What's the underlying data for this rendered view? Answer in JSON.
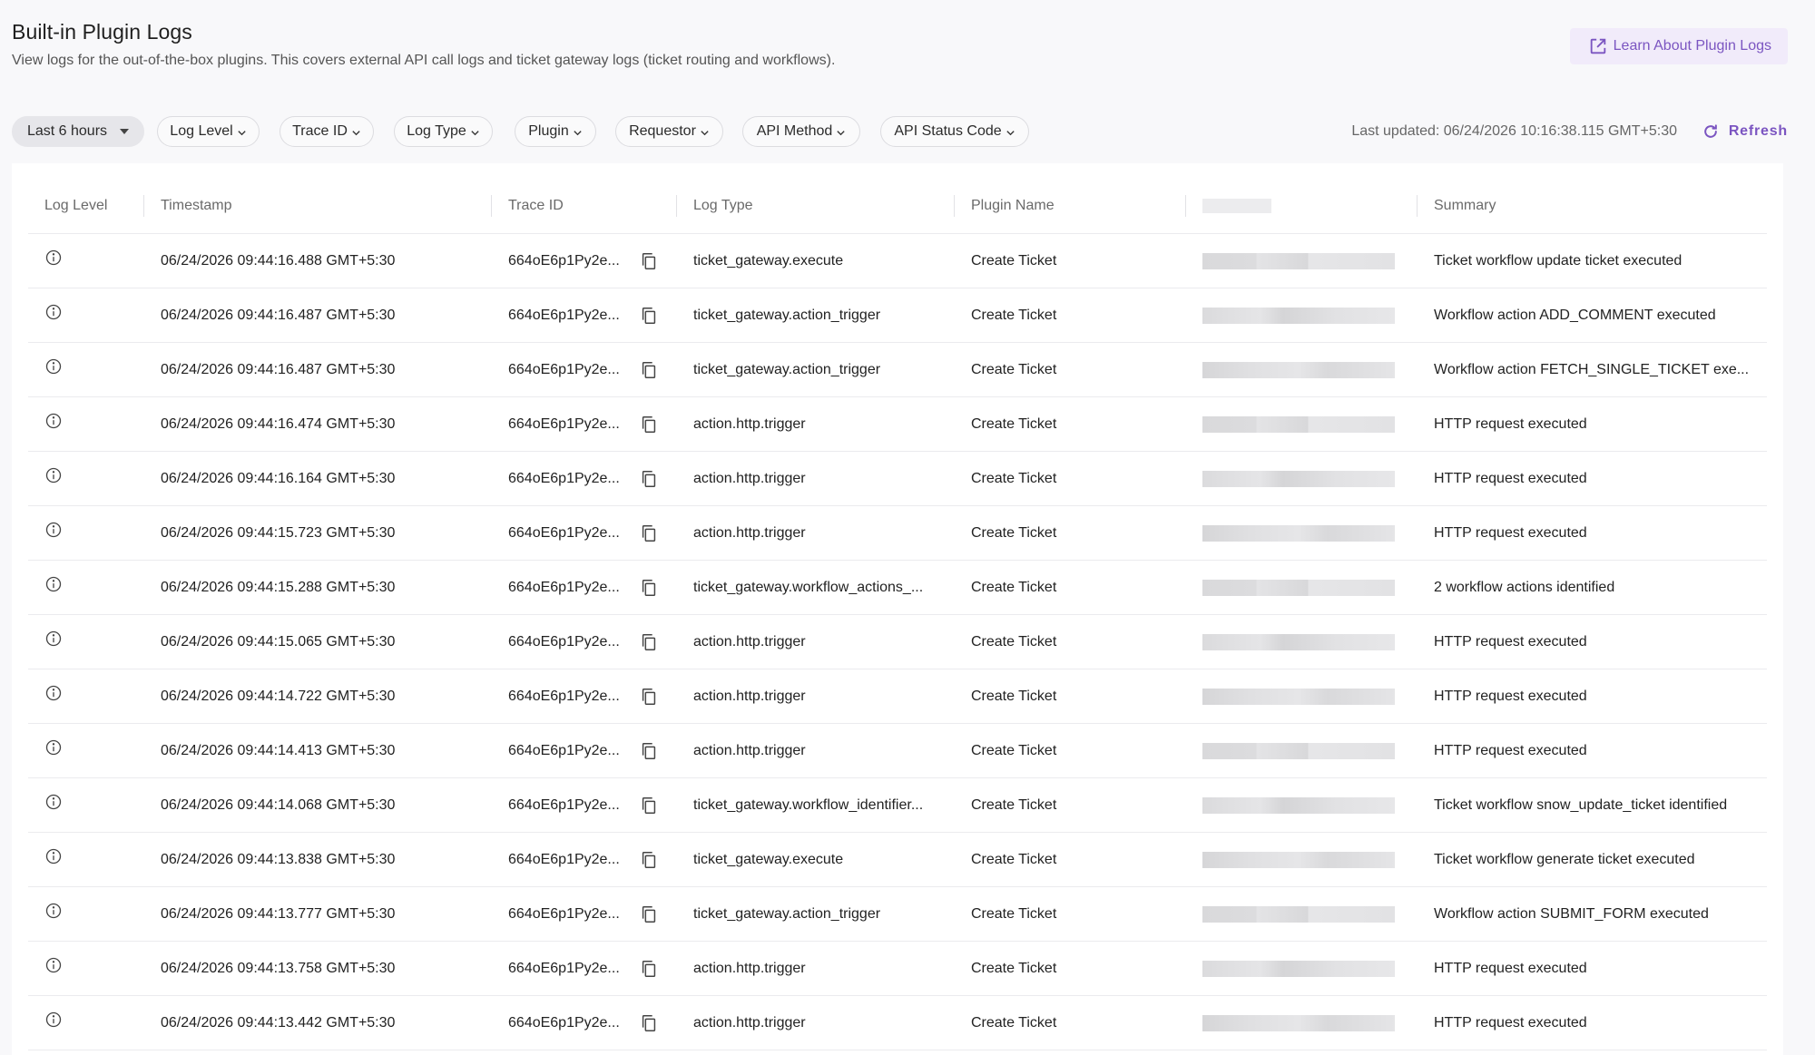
{
  "header": {
    "title": "Built-in Plugin Logs",
    "description": "View logs for the out-of-the-box plugins. This covers external API call logs and ticket gateway logs (ticket routing and workflows).",
    "learn_button": "Learn About Plugin Logs"
  },
  "filters": {
    "time_range": "Last 6 hours",
    "log_level": "Log Level",
    "trace_id": "Trace ID",
    "log_type": "Log Type",
    "plugin": "Plugin",
    "requestor": "Requestor",
    "api_method": "API Method",
    "api_status_code": "API Status Code"
  },
  "status": {
    "last_updated": "Last updated: 06/24/2026 10:16:38.115 GMT+5:30",
    "refresh_label": "Refresh"
  },
  "table": {
    "columns": {
      "log_level": "Log Level",
      "timestamp": "Timestamp",
      "trace_id": "Trace ID",
      "log_type": "Log Type",
      "plugin_name": "Plugin Name",
      "summary": "Summary"
    },
    "rows": [
      {
        "timestamp": "06/24/2026 09:44:16.488 GMT+5:30",
        "trace_id": "664oE6p1Py2e...",
        "log_type": "ticket_gateway.execute",
        "plugin_name": "Create Ticket",
        "summary": "Ticket workflow update ticket executed"
      },
      {
        "timestamp": "06/24/2026 09:44:16.487 GMT+5:30",
        "trace_id": "664oE6p1Py2e...",
        "log_type": "ticket_gateway.action_trigger",
        "plugin_name": "Create Ticket",
        "summary": "Workflow action ADD_COMMENT executed"
      },
      {
        "timestamp": "06/24/2026 09:44:16.487 GMT+5:30",
        "trace_id": "664oE6p1Py2e...",
        "log_type": "ticket_gateway.action_trigger",
        "plugin_name": "Create Ticket",
        "summary": "Workflow action FETCH_SINGLE_TICKET exe..."
      },
      {
        "timestamp": "06/24/2026 09:44:16.474 GMT+5:30",
        "trace_id": "664oE6p1Py2e...",
        "log_type": "action.http.trigger",
        "plugin_name": "Create Ticket",
        "summary": "HTTP request executed"
      },
      {
        "timestamp": "06/24/2026 09:44:16.164 GMT+5:30",
        "trace_id": "664oE6p1Py2e...",
        "log_type": "action.http.trigger",
        "plugin_name": "Create Ticket",
        "summary": "HTTP request executed"
      },
      {
        "timestamp": "06/24/2026 09:44:15.723 GMT+5:30",
        "trace_id": "664oE6p1Py2e...",
        "log_type": "action.http.trigger",
        "plugin_name": "Create Ticket",
        "summary": "HTTP request executed"
      },
      {
        "timestamp": "06/24/2026 09:44:15.288 GMT+5:30",
        "trace_id": "664oE6p1Py2e...",
        "log_type": "ticket_gateway.workflow_actions_...",
        "plugin_name": "Create Ticket",
        "summary": "2 workflow actions identified"
      },
      {
        "timestamp": "06/24/2026 09:44:15.065 GMT+5:30",
        "trace_id": "664oE6p1Py2e...",
        "log_type": "action.http.trigger",
        "plugin_name": "Create Ticket",
        "summary": "HTTP request executed"
      },
      {
        "timestamp": "06/24/2026 09:44:14.722 GMT+5:30",
        "trace_id": "664oE6p1Py2e...",
        "log_type": "action.http.trigger",
        "plugin_name": "Create Ticket",
        "summary": "HTTP request executed"
      },
      {
        "timestamp": "06/24/2026 09:44:14.413 GMT+5:30",
        "trace_id": "664oE6p1Py2e...",
        "log_type": "action.http.trigger",
        "plugin_name": "Create Ticket",
        "summary": "HTTP request executed"
      },
      {
        "timestamp": "06/24/2026 09:44:14.068 GMT+5:30",
        "trace_id": "664oE6p1Py2e...",
        "log_type": "ticket_gateway.workflow_identifier...",
        "plugin_name": "Create Ticket",
        "summary": "Ticket workflow snow_update_ticket identified"
      },
      {
        "timestamp": "06/24/2026 09:44:13.838 GMT+5:30",
        "trace_id": "664oE6p1Py2e...",
        "log_type": "ticket_gateway.execute",
        "plugin_name": "Create Ticket",
        "summary": "Ticket workflow generate ticket executed"
      },
      {
        "timestamp": "06/24/2026 09:44:13.777 GMT+5:30",
        "trace_id": "664oE6p1Py2e...",
        "log_type": "ticket_gateway.action_trigger",
        "plugin_name": "Create Ticket",
        "summary": "Workflow action SUBMIT_FORM executed"
      },
      {
        "timestamp": "06/24/2026 09:44:13.758 GMT+5:30",
        "trace_id": "664oE6p1Py2e...",
        "log_type": "action.http.trigger",
        "plugin_name": "Create Ticket",
        "summary": "HTTP request executed"
      },
      {
        "timestamp": "06/24/2026 09:44:13.442 GMT+5:30",
        "trace_id": "664oE6p1Py2e...",
        "log_type": "action.http.trigger",
        "plugin_name": "Create Ticket",
        "summary": "HTTP request executed"
      }
    ]
  },
  "icons": {
    "log_level": "info-circle-icon",
    "trace_copy": "copy-icon",
    "learn": "external-link-icon",
    "refresh": "refresh-icon",
    "filter_chevron": "chevron-down-icon"
  },
  "colors": {
    "accent": "#7b55c1",
    "accent_bg": "#f1ebfa",
    "page_bg": "#f8f8fa"
  }
}
